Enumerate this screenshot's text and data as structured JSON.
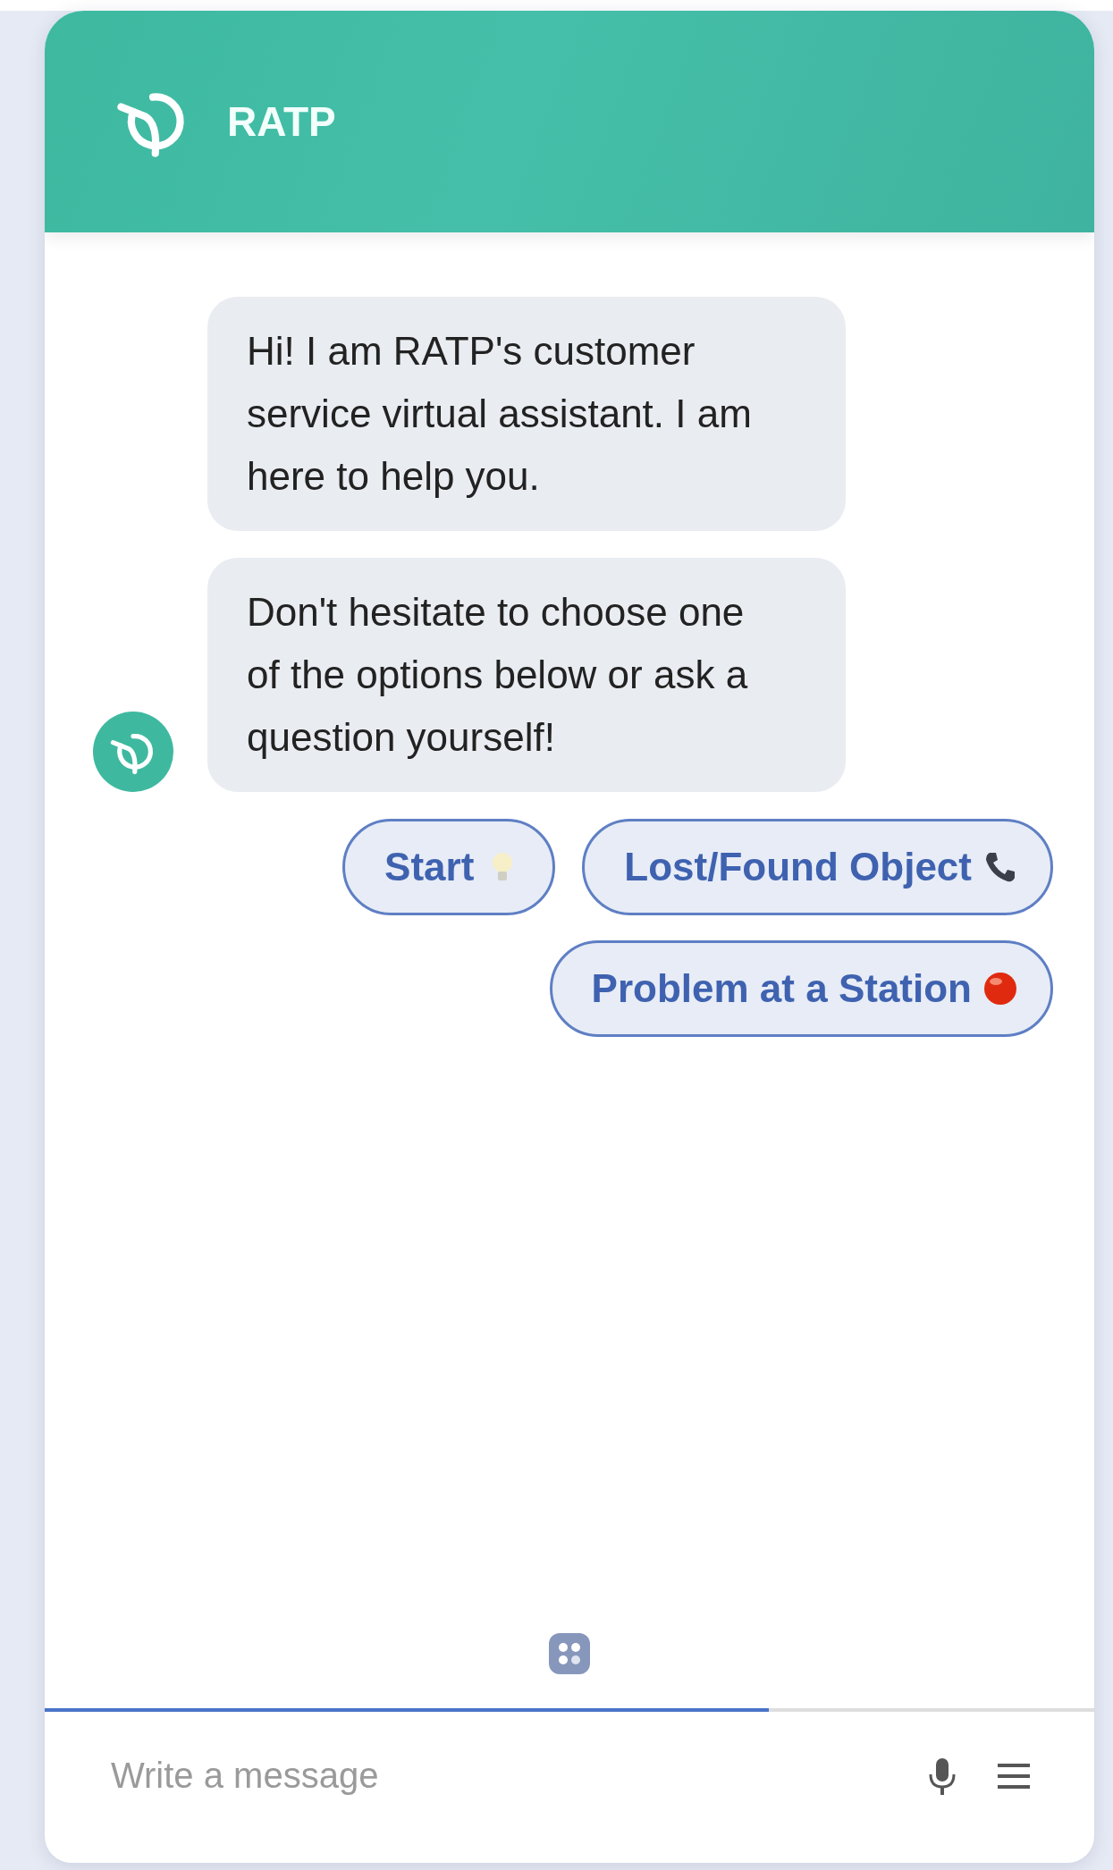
{
  "header": {
    "title": "RATP"
  },
  "messages": [
    {
      "text": "Hi! I am RATP's customer service virtual assistant. I am here to help you.",
      "avatar": false
    },
    {
      "text": "Don't hesitate to choose one of the options below or ask a question yourself!",
      "avatar": true
    }
  ],
  "quick_replies": [
    {
      "label": "Start",
      "kind": "bulb"
    },
    {
      "label": "Lost/Found Object",
      "kind": "phone"
    },
    {
      "label": "Problem at a Station",
      "kind": "red-dot"
    }
  ],
  "progress": {
    "level": 0.69
  },
  "composer": {
    "placeholder": "Write a message"
  }
}
